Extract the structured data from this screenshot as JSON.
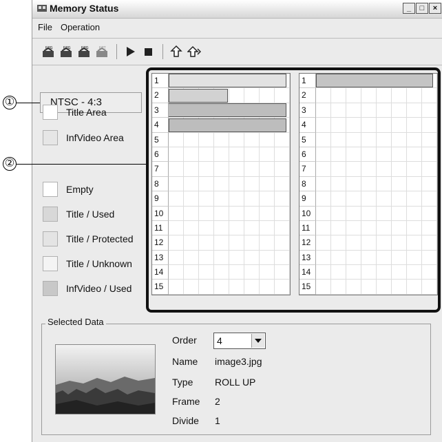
{
  "window": {
    "title": "Memory Status",
    "app_icon": "memory-app-icon"
  },
  "window_buttons": {
    "minimize": "_",
    "maximize": "□",
    "close": "×"
  },
  "menu": [
    "File",
    "Operation"
  ],
  "toolbar": {
    "icons": [
      "epg-read-1-icon",
      "epg-read-2-icon",
      "epg-read-3-icon",
      "epg-write-icon",
      "play-icon",
      "stop-icon",
      "upload-icon",
      "download-icon"
    ],
    "tb_labels": {
      "epg1": "EPG",
      "epg2": "EPG",
      "epg3": "EPG",
      "epg4": "EPT"
    }
  },
  "callouts": {
    "mode": "①",
    "grid": "②"
  },
  "mode_display": "NTSC - 4:3",
  "legend_areas": [
    "Title Area",
    "InfVideo Area"
  ],
  "legend_status": [
    "Empty",
    "Title / Used",
    "Title / Protected",
    "Title / Unknown",
    "InfVideo / Used"
  ],
  "colors": {
    "title_area": "#ffffff",
    "infvideo_area": "#e6e6e6",
    "empty": "#ffffff",
    "title_used": "#d8d8d8",
    "title_protected": "#e4e4e4",
    "title_unknown": "#f4f4f4",
    "infvideo_used": "#c8c8c8",
    "bar_light": "#e2e2e2",
    "bar_dark": "#bdbdbd"
  },
  "grid_rows": [
    "1",
    "2",
    "3",
    "4",
    "5",
    "6",
    "7",
    "8",
    "9",
    "10",
    "11",
    "12",
    "13",
    "14",
    "15"
  ],
  "selected_data": {
    "group_label": "Selected Data",
    "order_label": "Order",
    "order_value": "4",
    "name_label": "Name",
    "name_value": "image3.jpg",
    "type_label": "Type",
    "type_value": "ROLL UP",
    "frame_label": "Frame",
    "frame_value": "2",
    "divide_label": "Divide",
    "divide_value": "1"
  }
}
